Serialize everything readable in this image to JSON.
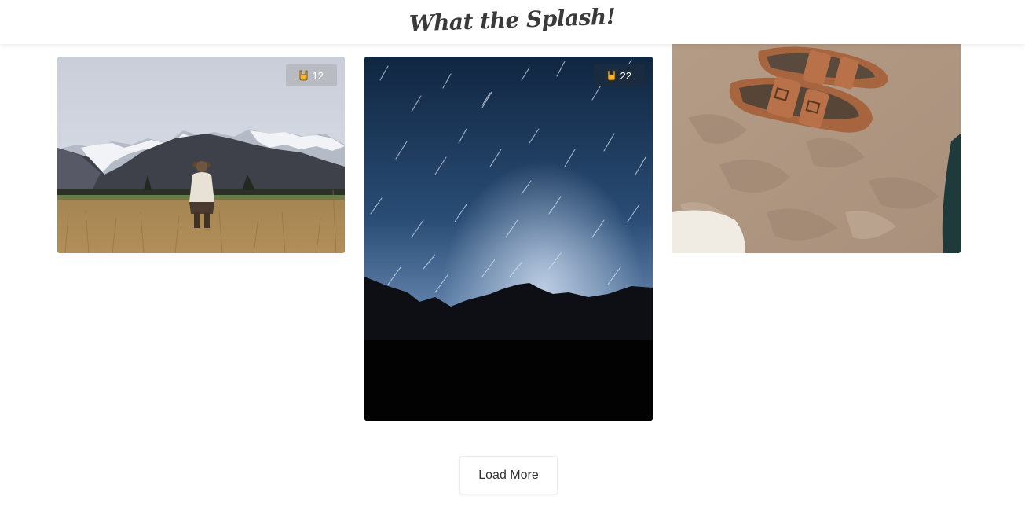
{
  "header": {
    "title": "What the Splash!"
  },
  "photos": [
    {
      "alt_subject": "person in field with mountains",
      "likes": "12",
      "badge_color": "#b8bcc2"
    },
    {
      "alt_subject": "star trails over mountain silhouette",
      "likes": "22",
      "badge_color": "#1a2b40"
    },
    {
      "alt_subject": "sandals on sand",
      "likes": "",
      "badge_color": ""
    }
  ],
  "footer": {
    "load_more_label": "Load More"
  },
  "icons": {
    "like": "rock-hand-icon"
  },
  "colors": {
    "title": "#3a3a3a",
    "accent_gold": "#f2b533"
  }
}
